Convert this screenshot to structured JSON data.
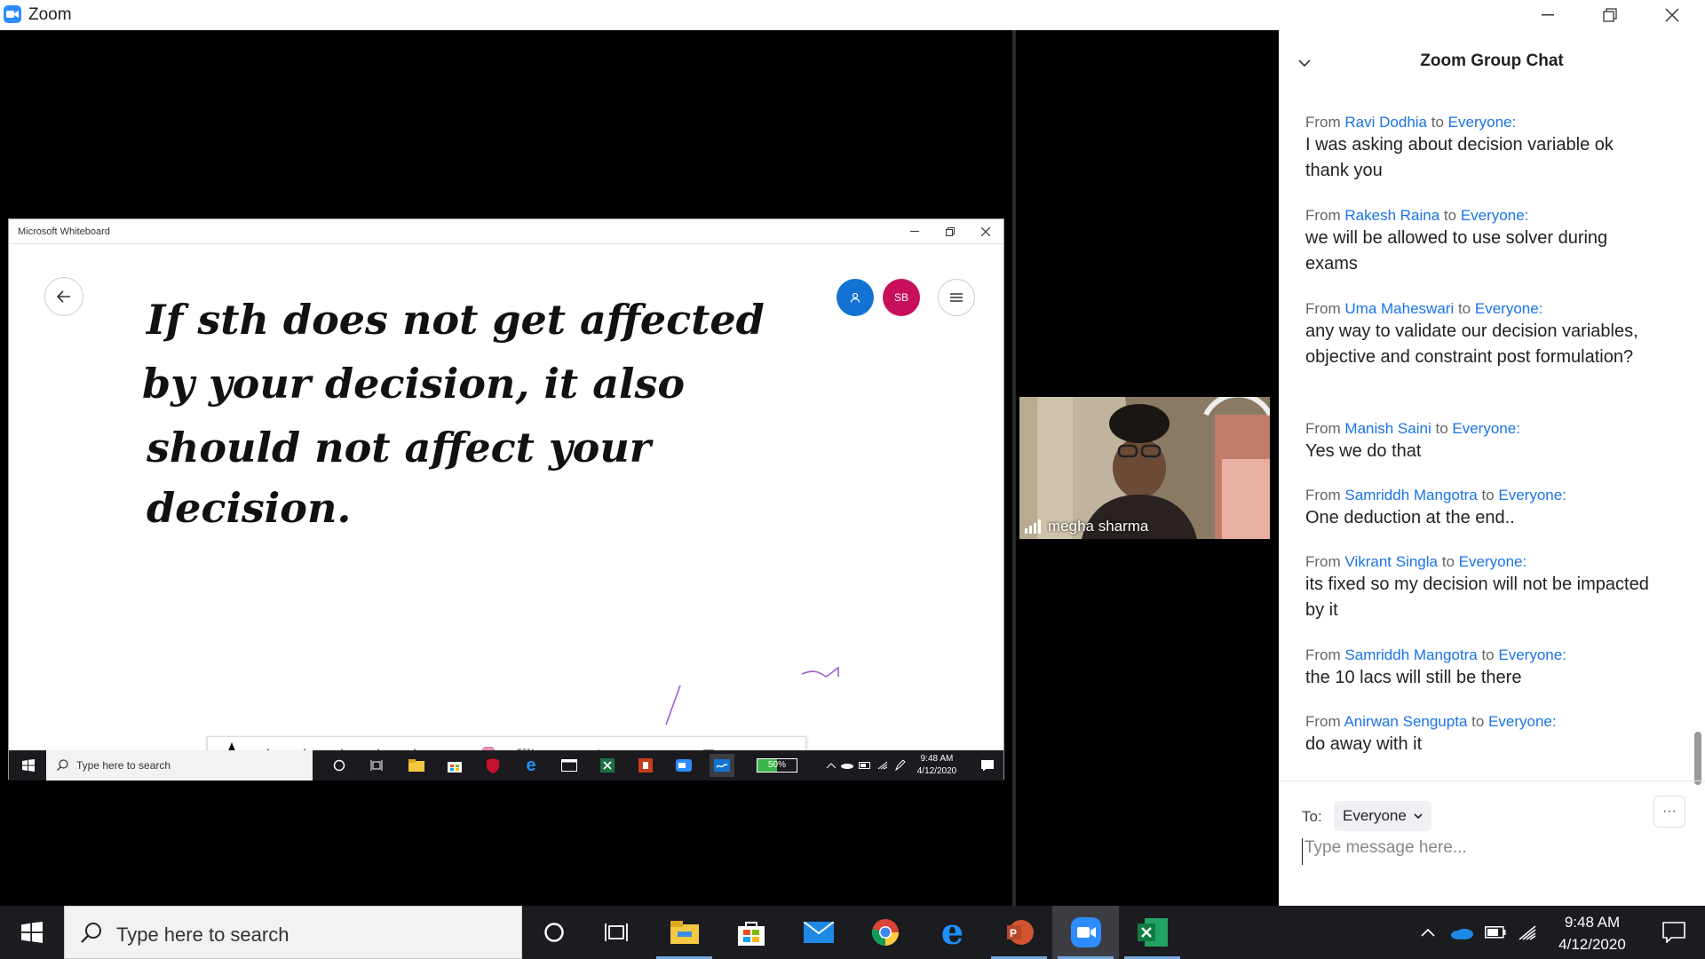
{
  "zoom": {
    "title": "Zoom"
  },
  "whiteboard": {
    "title": "Microsoft Whiteboard",
    "avatar_initials": "SB",
    "handwriting": [
      "If sth does not get affected",
      "by your decision, it also",
      "should not affect your",
      "decision."
    ]
  },
  "inner_taskbar": {
    "search_placeholder": "Type here to search",
    "battery": "50%",
    "time": "9:48 AM",
    "date": "4/12/2020"
  },
  "video": {
    "participant_name": "megha sharma"
  },
  "chat": {
    "title": "Zoom Group Chat",
    "messages": [
      {
        "from_prefix": "From",
        "sender": "Ravi Dodhia",
        "to_word": "to",
        "recipient": "Everyone:",
        "text": "I was asking about decision variable ok thank you"
      },
      {
        "from_prefix": "From",
        "sender": "Rakesh Raina",
        "to_word": "to",
        "recipient": "Everyone:",
        "text": "we will be allowed to use solver during exams"
      },
      {
        "from_prefix": "From",
        "sender": "Uma Maheswari",
        "to_word": "to",
        "recipient": "Everyone:",
        "text": "any way to validate our decision variables, objective and constraint post formulation?"
      },
      {
        "from_prefix": "From",
        "sender": "Manish Saini",
        "to_word": "to",
        "recipient": "Everyone:",
        "text": "Yes we do that"
      },
      {
        "from_prefix": "From",
        "sender": "Samriddh Mangotra",
        "to_word": "to",
        "recipient": "Everyone:",
        "text": "One deduction at the end.."
      },
      {
        "from_prefix": "From",
        "sender": "Vikrant Singla",
        "to_word": "to",
        "recipient": "Everyone:",
        "text": "its fixed so my decision will not be impacted by it"
      },
      {
        "from_prefix": "From",
        "sender": "Samriddh Mangotra",
        "to_word": "to",
        "recipient": "Everyone:",
        "text": "the 10 lacs will still be there"
      },
      {
        "from_prefix": "From",
        "sender": "Anirwan Sengupta",
        "to_word": "to",
        "recipient": "Everyone:",
        "text": "do away with it"
      }
    ],
    "to_label": "To:",
    "to_value": "Everyone",
    "more_label": "···",
    "input_placeholder": "Type message here..."
  },
  "taskbar": {
    "search_placeholder": "Type here to search",
    "time": "9:48 AM",
    "date": "4/12/2020"
  },
  "colors": {
    "zoom_blue": "#2D8CFF",
    "link_blue": "#1a73e8",
    "avatar_pink": "#C8105A",
    "avatar_blue": "#1273D3"
  }
}
